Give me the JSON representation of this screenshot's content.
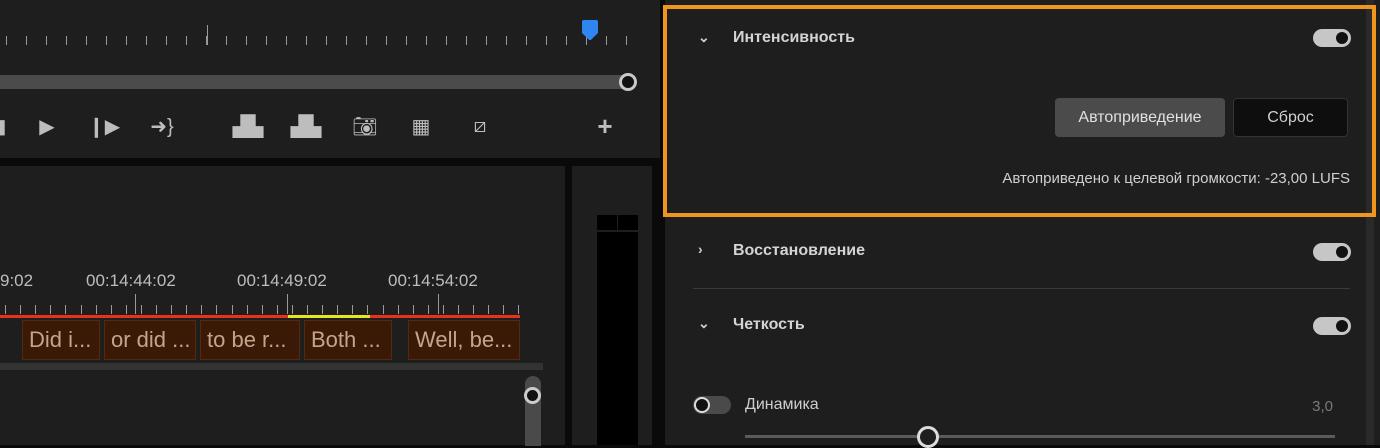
{
  "timeline": {
    "timecodes": [
      "9:02",
      "00:14:44:02",
      "00:14:49:02",
      "00:14:54:02"
    ],
    "clips": [
      "Did i...",
      "or did ...",
      "to be r...",
      "Both ...",
      "Well, be..."
    ]
  },
  "panel": {
    "intensity": {
      "title": "Интенсивность",
      "enabled": true,
      "auto_button": "Автоприведение",
      "reset_button": "Сброс",
      "status": "Автоприведено к целевой громкости: -23,00 LUFS"
    },
    "restoration": {
      "title": "Восстановление",
      "enabled": true
    },
    "clarity": {
      "title": "Четкость",
      "enabled": true
    },
    "dynamics": {
      "label": "Динамика",
      "enabled": false,
      "value": "3,0",
      "slider_fraction": 0.31
    }
  },
  "colors": {
    "highlight": "#f0961e",
    "playhead": "#2f86f0",
    "range_red": "#e8321e",
    "range_yellow": "#e6e61e"
  }
}
